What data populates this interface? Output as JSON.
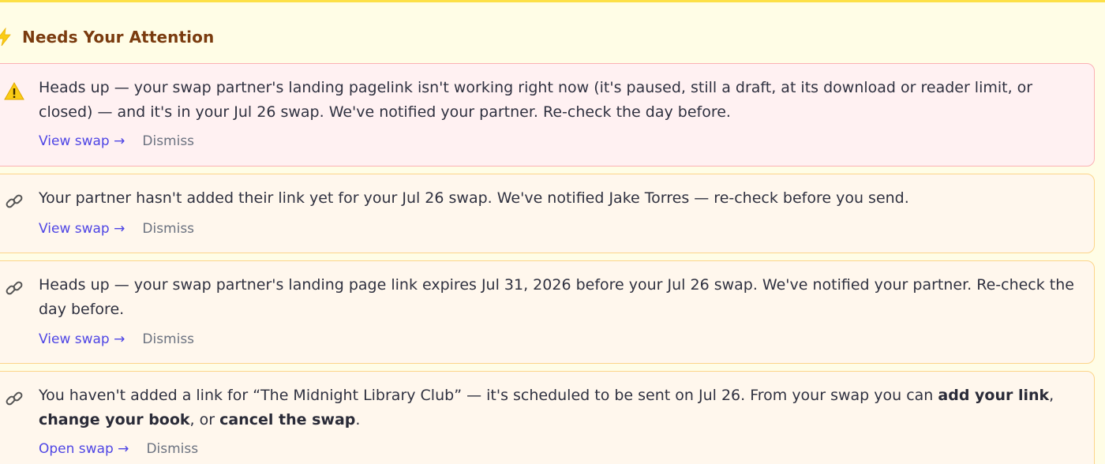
{
  "header": {
    "title": "Needs Your Attention",
    "icon": "lightning-bolt-icon"
  },
  "colors": {
    "banner_border": "#fde047",
    "title": "#7a3b0f",
    "link": "#4f46e5",
    "danger_bg": "#fff1f2",
    "danger_border": "#fbb1b5",
    "notice_bg": "#fff7ed",
    "notice_border": "#fcd58a"
  },
  "alerts": [
    {
      "icon": "warning-icon",
      "severity": "danger",
      "text": "Heads up — your swap partner's landing pagelink isn't working right now (it's paused, still a draft, at its download or reader limit, or closed) — and it's in your Jul 26 swap. We've notified your partner. Re-check the day before.",
      "action_label": "View swap →",
      "dismiss_label": "Dismiss"
    },
    {
      "icon": "link-icon",
      "severity": "notice",
      "text": "Your partner hasn't added their link yet for your Jul 26 swap. We've notified Jake Torres — re-check before you send.",
      "action_label": "View swap →",
      "dismiss_label": "Dismiss"
    },
    {
      "icon": "link-icon",
      "severity": "notice",
      "text": "Heads up — your swap partner's landing page link expires Jul 31, 2026 before your Jul 26 swap. We've notified your partner. Re-check the day before.",
      "action_label": "View swap →",
      "dismiss_label": "Dismiss"
    },
    {
      "icon": "link-icon",
      "severity": "notice",
      "text_parts": {
        "lead": "You haven't added a link for “The Midnight Library Club” — it's scheduled to be sent on Jul 26. From your swap you can ",
        "add_link": "add your link",
        "sep1": ", ",
        "change_book": "change your book",
        "sep2": ", or ",
        "cancel_swap": "cancel the swap",
        "end": "."
      },
      "action_label": "Open swap →",
      "dismiss_label": "Dismiss"
    }
  ]
}
